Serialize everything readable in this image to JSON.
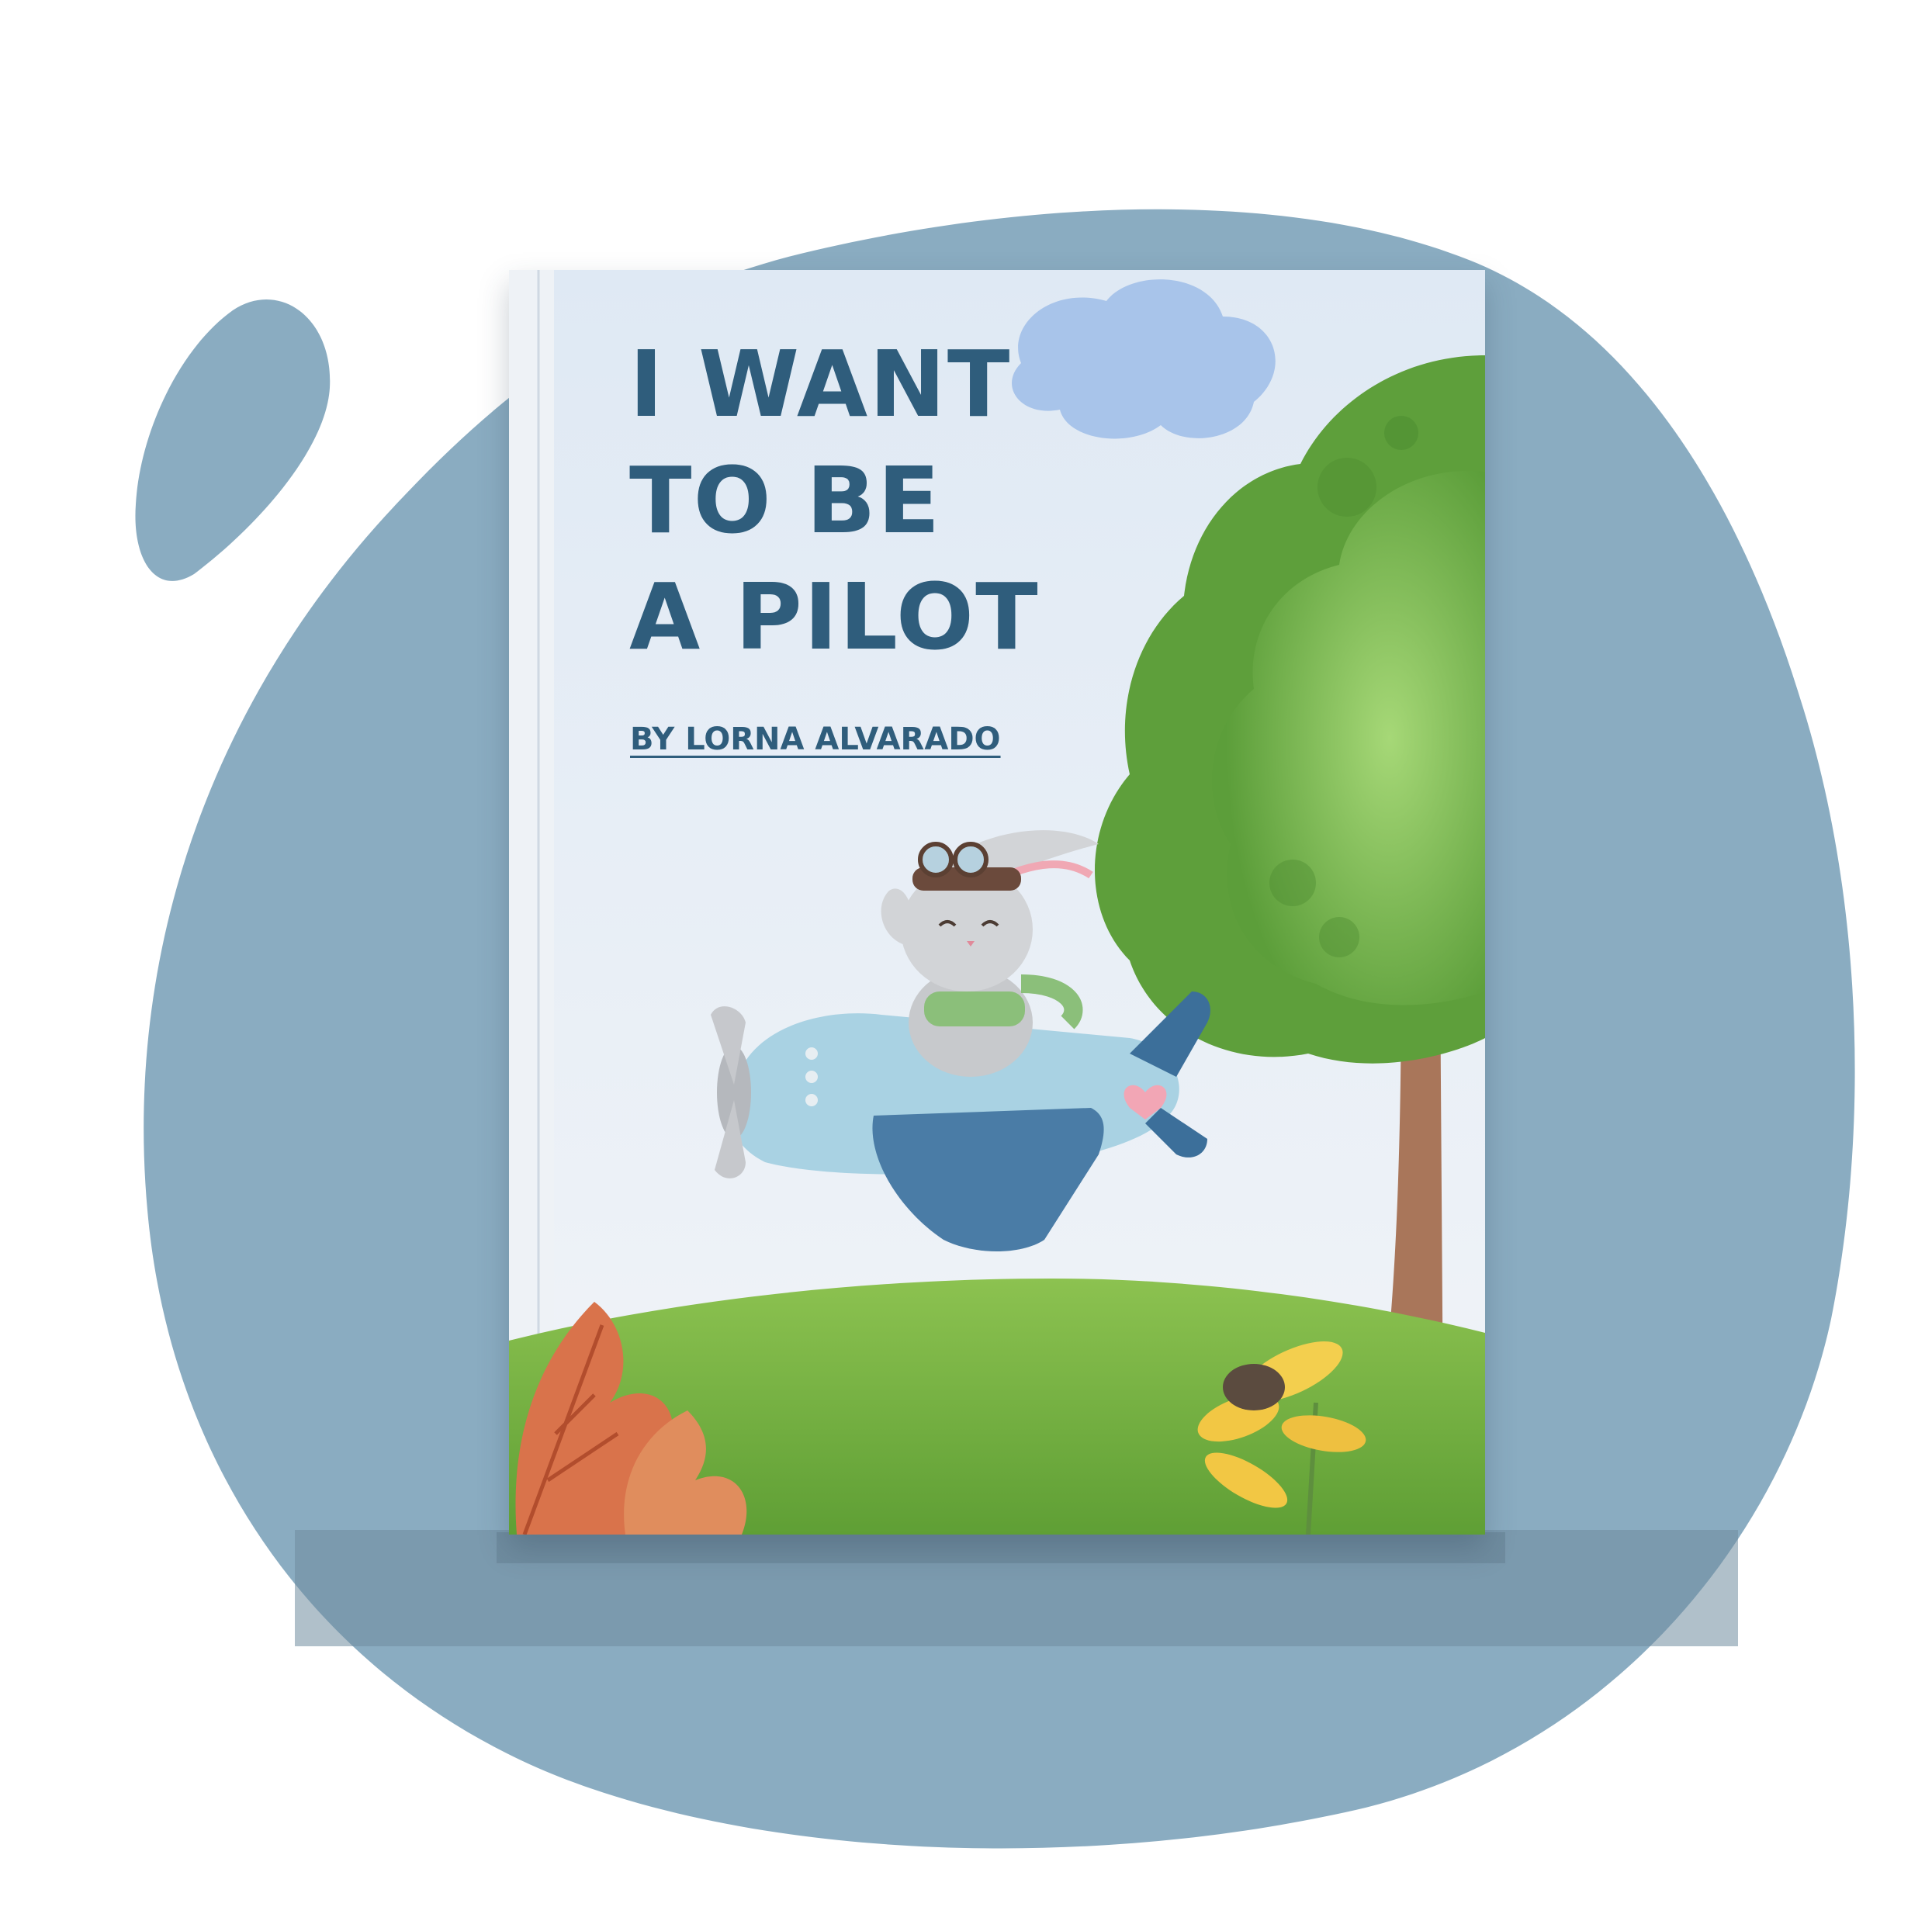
{
  "book": {
    "title_lines": [
      "I WANT",
      "TO BE",
      "A PILOT"
    ],
    "author": "BY LORNA ALVARADO"
  },
  "colors": {
    "backdrop_blob": "#8aacc1",
    "shelf": "#6f8c9f",
    "title_text": "#2f5d7c",
    "sky": "#e6eef7",
    "grass": "#7cb342",
    "tree_foliage": "#6fb04a",
    "airplane": "#a9d2e3"
  },
  "icons": {
    "cloud": "cloud-icon",
    "tree": "tree-icon",
    "bunny_pilot": "bunny-pilot-icon",
    "airplane": "airplane-icon",
    "leaves": "autumn-leaves-icon",
    "flower": "sunflower-icon"
  }
}
